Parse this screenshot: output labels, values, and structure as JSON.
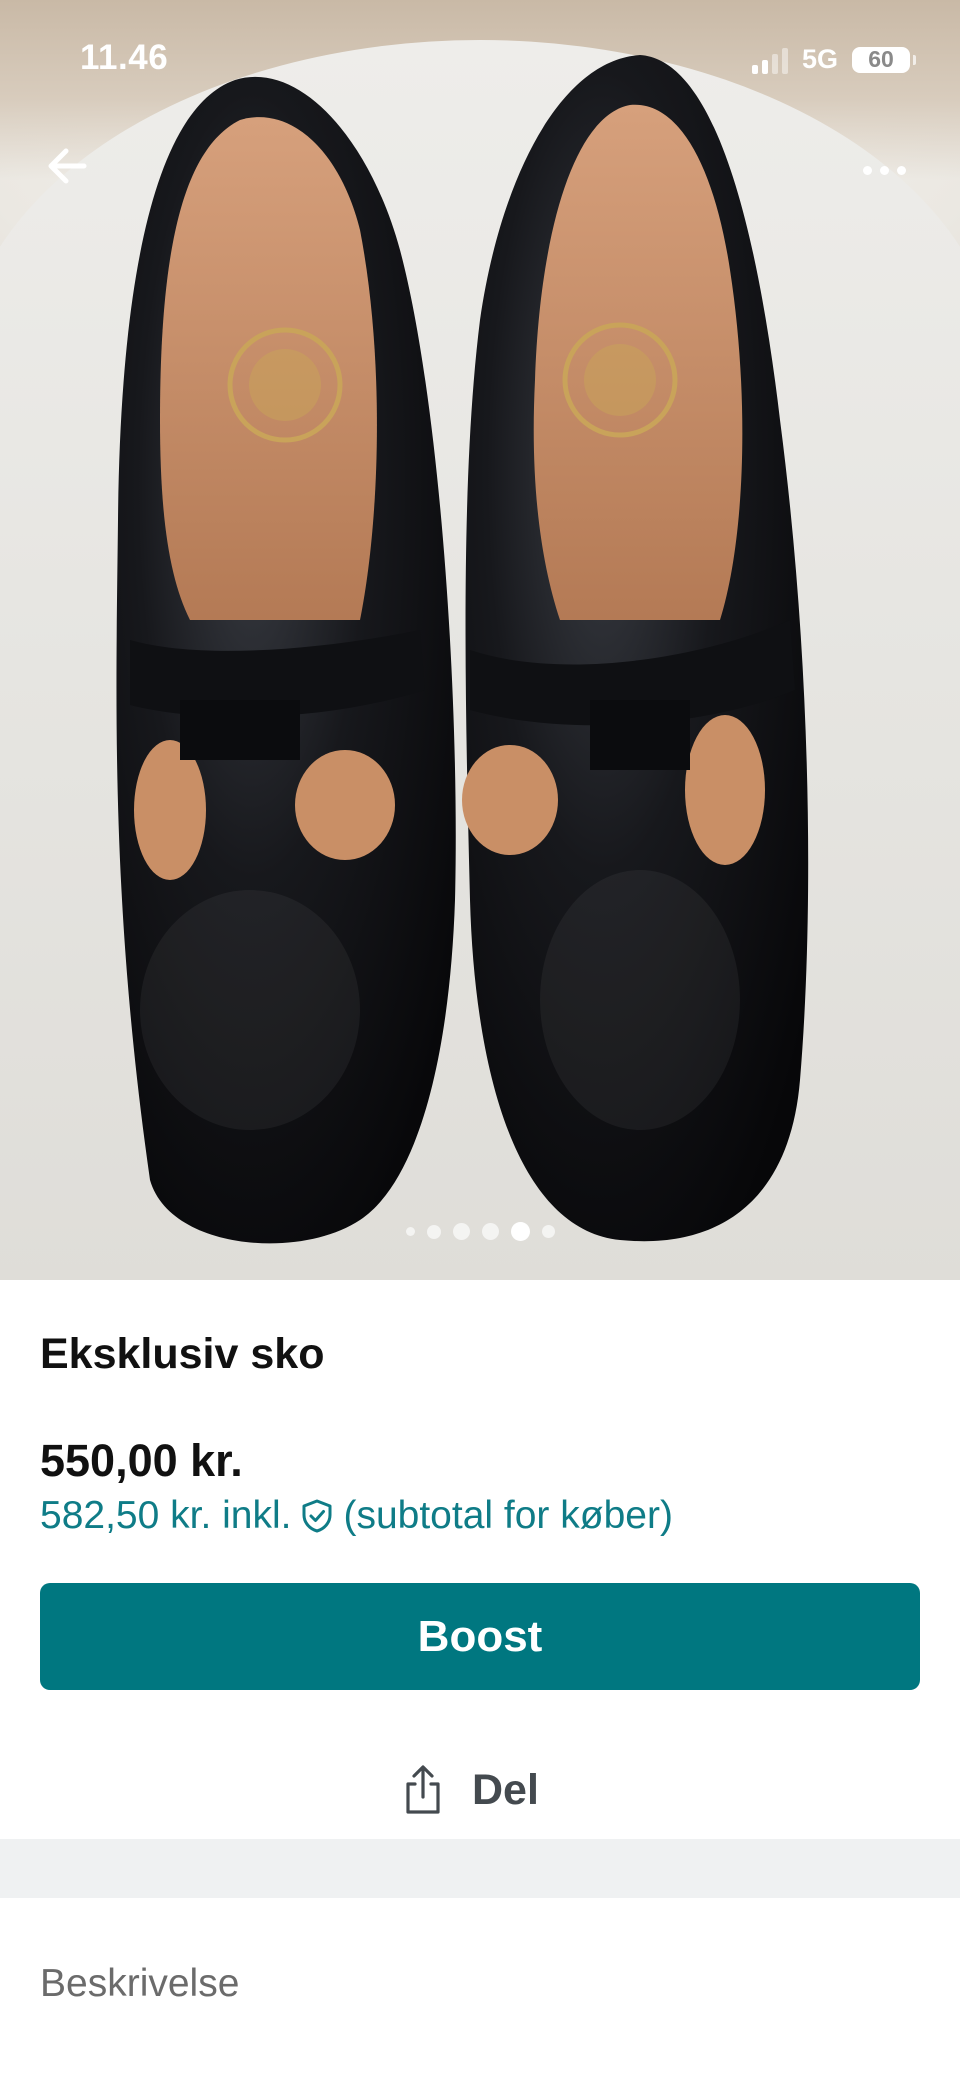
{
  "status_bar": {
    "time": "11.46",
    "network": "5G",
    "battery": "60"
  },
  "gallery": {
    "image": "black leather t-strap high-heel shoes on white table",
    "photo_count": 6,
    "active_index": 4
  },
  "header": {
    "back_icon": "arrow-left-icon",
    "more_icon": "more-horizontal-icon"
  },
  "item": {
    "title": "Eksklusiv sko",
    "price": "550,00 kr.",
    "price_incl_amount": "582,50 kr. inkl.",
    "price_incl_note": "(subtotal for køber)",
    "protection_icon": "shield-check-icon"
  },
  "actions": {
    "boost_label": "Boost",
    "share_label": "Del",
    "share_icon": "share-icon"
  },
  "sections": {
    "description_label": "Beskrivelse"
  },
  "colors": {
    "accent": "#007780",
    "accent_text": "#0f7c87",
    "separator": "#eff1f2"
  }
}
